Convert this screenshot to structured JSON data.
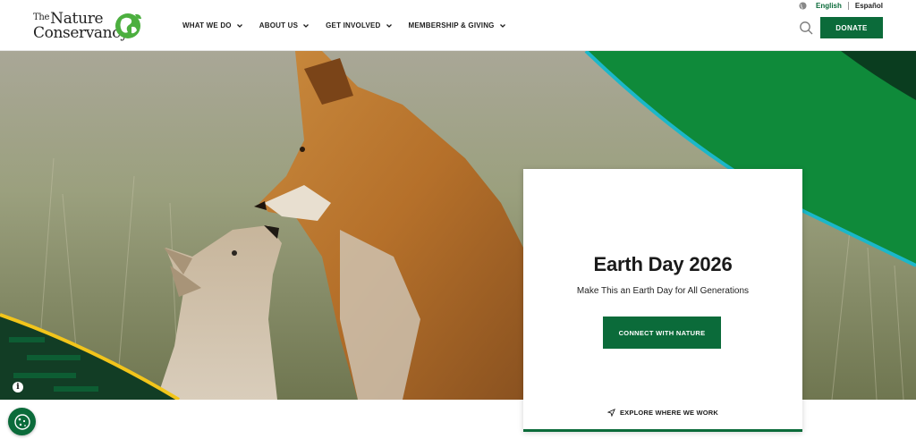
{
  "brand": {
    "logo_line1_small": "The",
    "logo_line1": "Nature",
    "logo_line2": "Conservancy",
    "green": "#0b6b3a"
  },
  "nav": {
    "items": [
      {
        "label": "WHAT WE DO"
      },
      {
        "label": "ABOUT US"
      },
      {
        "label": "GET INVOLVED"
      },
      {
        "label": "MEMBERSHIP & GIVING"
      }
    ]
  },
  "language": {
    "english": "English",
    "spanish": "Español"
  },
  "header": {
    "donate_label": "DONATE",
    "search_icon": "search-icon"
  },
  "hero": {
    "title": "Earth Day 2026",
    "subtitle": "Make This an Earth Day for All Generations",
    "cta_label": "CONNECT WITH NATURE",
    "explore_label": "EXPLORE WHERE WE WORK",
    "info_label": "i"
  }
}
